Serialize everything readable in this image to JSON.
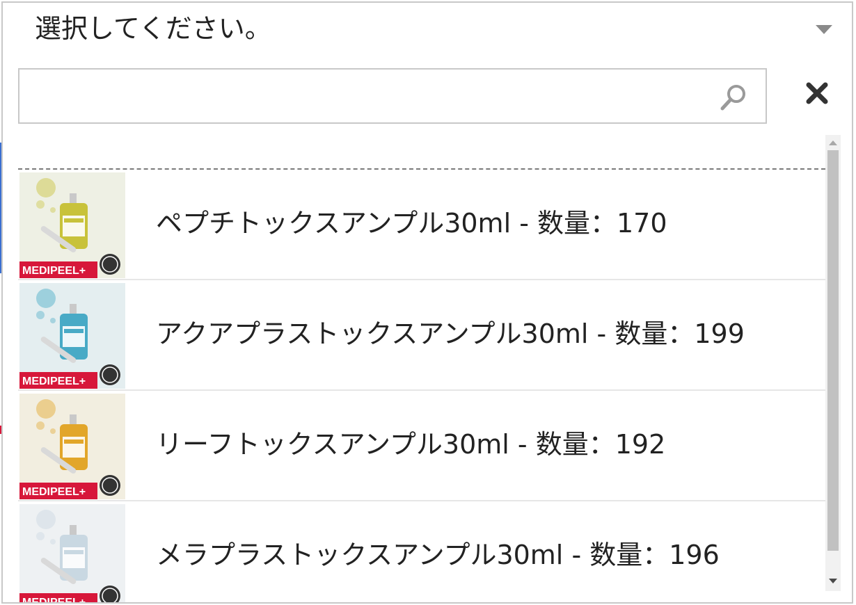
{
  "select": {
    "placeholder": "選択してください。",
    "caret_icon": "caret-down-icon"
  },
  "search": {
    "value": "",
    "placeholder": "",
    "search_icon": "search-icon",
    "close_icon": "close-icon"
  },
  "options": [
    {
      "label": "ペプチトックスアンプル30ml - 数量：170",
      "thumb_brand": "MEDIPEEL+",
      "thumb_product": "Peptide-Tox",
      "accent": "#c8c23a",
      "bg": "#eef0e4"
    },
    {
      "label": "アクアプラストックスアンプル30ml - 数量：199",
      "thumb_brand": "MEDIPEEL+",
      "thumb_product": "Aqua-Tox",
      "accent": "#48aac6",
      "bg": "#e4eef0"
    },
    {
      "label": "リーフトックスアンプル30ml - 数量：192",
      "thumb_brand": "MEDIPEEL+",
      "thumb_product": "Lif-Tox",
      "accent": "#e2a62a",
      "bg": "#f2eee0"
    },
    {
      "label": "メラプラストックスアンプル30ml - 数量：196",
      "thumb_brand": "MEDIPEEL+",
      "thumb_product": "Mela-Tox",
      "accent": "#c9d8e2",
      "bg": "#eef1f3"
    }
  ],
  "colors": {
    "border": "#c8c8c8",
    "brand_red": "#d7173a",
    "scroll_thumb": "#c1c1c1"
  }
}
